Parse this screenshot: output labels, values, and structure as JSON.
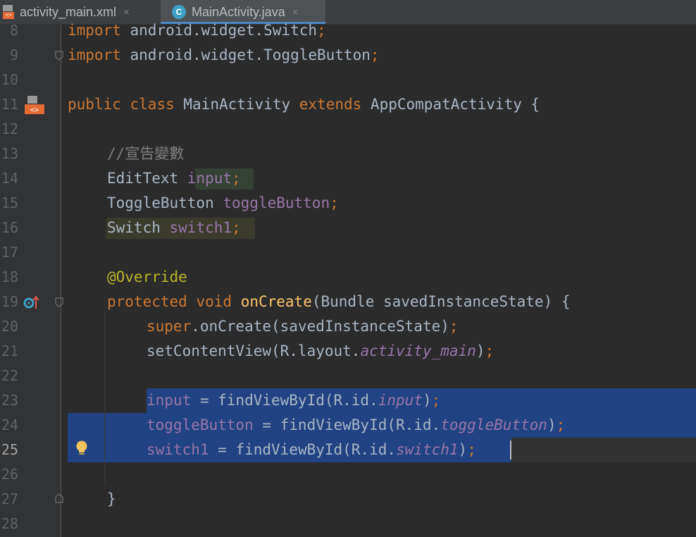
{
  "tabs": [
    {
      "label": "activity_main.xml",
      "icon": "xml-layout-file-icon",
      "active": false
    },
    {
      "label": "MainActivity.java",
      "icon": "java-class-c-icon",
      "icon_letter": "C",
      "active": true
    }
  ],
  "tab_close_glyph": "×",
  "gutter": {
    "line_numbers": [
      "8",
      "9",
      "10",
      "11",
      "12",
      "13",
      "14",
      "15",
      "16",
      "17",
      "18",
      "19",
      "20",
      "21",
      "22",
      "23",
      "24",
      "25",
      "26",
      "27",
      "28"
    ],
    "current_line": "25",
    "icons": [
      "layout-file-icon",
      "override-method-icon",
      "lightbulb-intention-icon"
    ]
  },
  "code": {
    "l8": {
      "kw": "import",
      "rest": " android.widget.Switch",
      "semi": ";"
    },
    "l9": {
      "kw": "import",
      "rest": " android.widget.ToggleButton",
      "semi": ";"
    },
    "l11": {
      "kw1": "public",
      "kw2": "class",
      "name": "MainActivity",
      "kw3": "extends",
      "rest": " AppCompatActivity {"
    },
    "l13": {
      "comment": "//宣告變數"
    },
    "l14": {
      "type": "EditText ",
      "field": "input",
      "semi": ";"
    },
    "l15": {
      "type": "ToggleButton ",
      "field": "toggleButton",
      "semi": ";"
    },
    "l16": {
      "type": "Switch ",
      "field": "switch1",
      "semi": ";"
    },
    "l18": {
      "annotation": "@Override"
    },
    "l19": {
      "kw1": "protected",
      "kw2": "void",
      "method": "onCreate",
      "rest": "(Bundle savedInstanceState) {"
    },
    "l20": {
      "kw": "super",
      "rest": ".onCreate(savedInstanceState)",
      "semi": ";"
    },
    "l21": {
      "pre": "setContentView(R.layout.",
      "static": "activity_main",
      "post": ")",
      "semi": ";"
    },
    "l23": {
      "field": "input",
      "pre": " = findViewById(R.id.",
      "static": "input",
      "post": ")",
      "semi": ";"
    },
    "l24": {
      "field": "toggleButton",
      "pre": " = findViewById(R.id.",
      "static": "toggleButton",
      "post": ")",
      "semi": ";"
    },
    "l25": {
      "field": "switch1",
      "pre": " = findViewById(R.id.",
      "static": "switch1",
      "post": ")",
      "semi": ";"
    },
    "l27": {
      "brace": "}"
    }
  },
  "colors": {
    "background": "#2b2b2b",
    "gutter": "#313335",
    "selection": "#214283",
    "keyword": "#cc7832",
    "field": "#9876aa",
    "method": "#ffc66d",
    "comment": "#808080",
    "annotation": "#bbb529",
    "text": "#a9b7c6"
  }
}
